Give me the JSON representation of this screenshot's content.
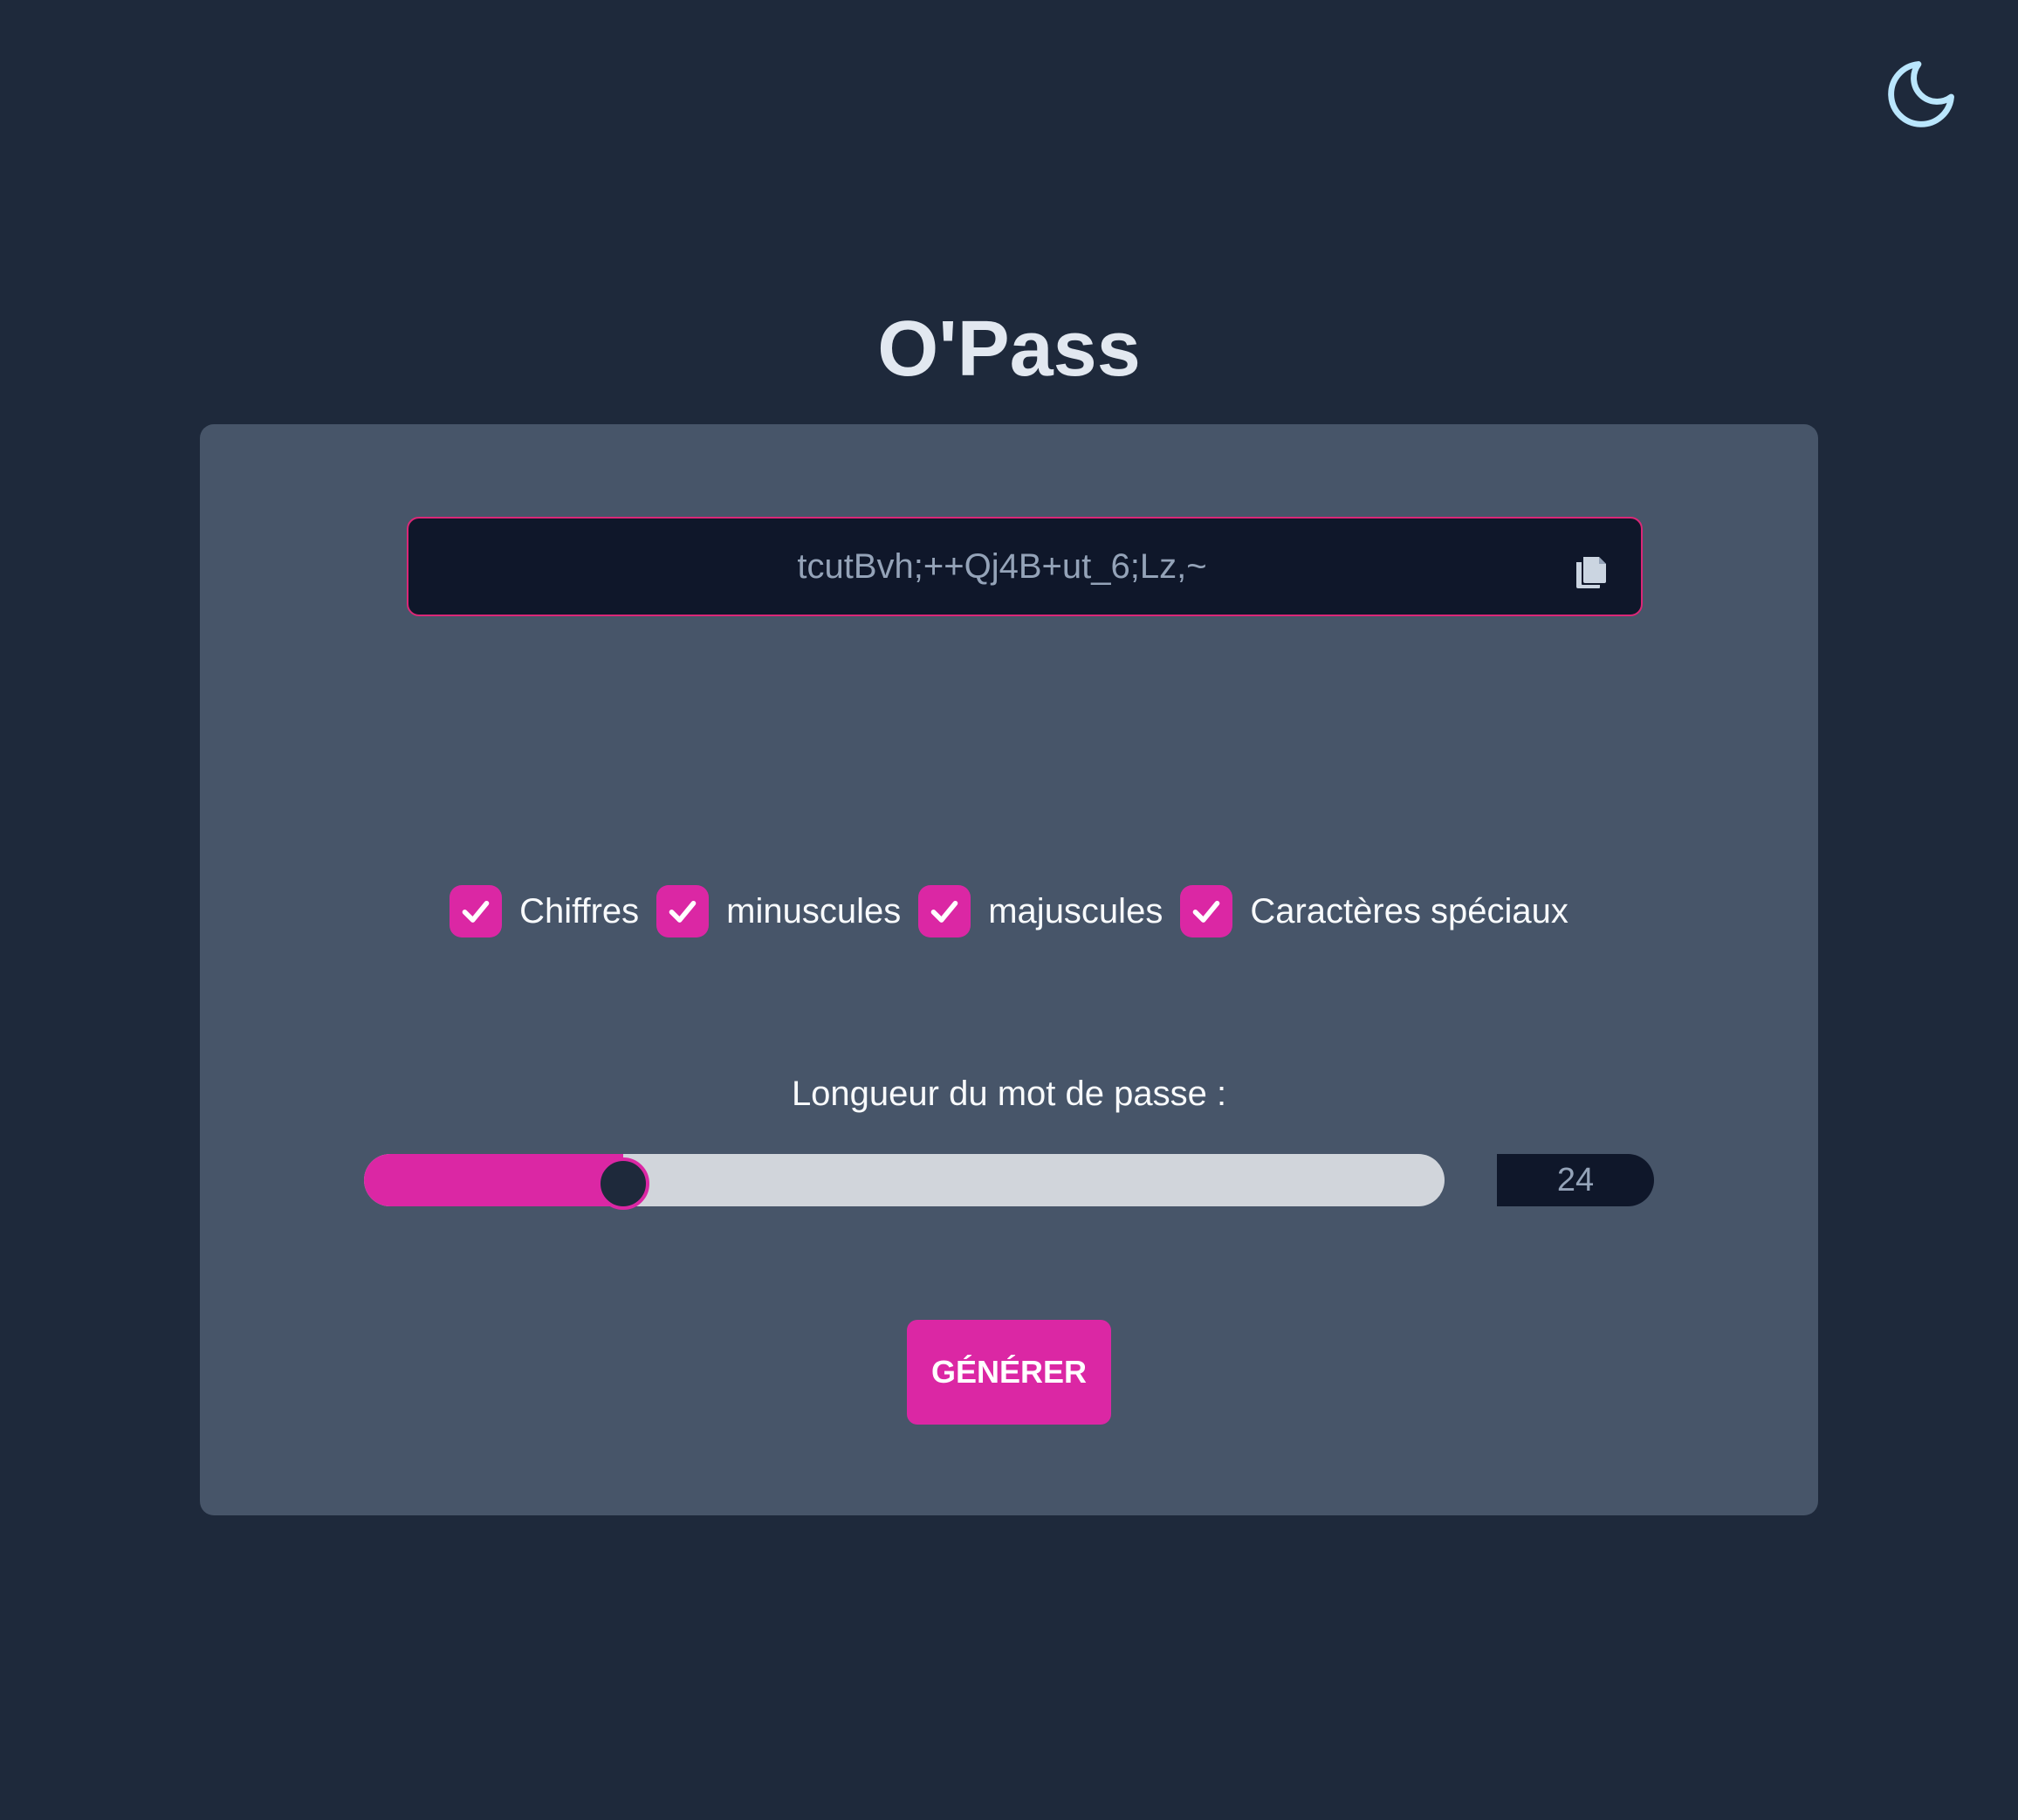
{
  "app": {
    "title": "O'Pass",
    "theme_toggle_icon": "moon-icon"
  },
  "password": {
    "value": "tcutBvh;++Qj4B+ut_6;Lz,~",
    "copy_icon": "copy-icon"
  },
  "options": [
    {
      "label": "Chiffres",
      "checked": true
    },
    {
      "label": "minuscules",
      "checked": true
    },
    {
      "label": "majuscules",
      "checked": true
    },
    {
      "label": "Caractères spéciaux",
      "checked": true
    }
  ],
  "length": {
    "label": "Longueur du mot de passe :",
    "value": "24",
    "slider_fraction": 0.24
  },
  "generate_button": {
    "label": "GÉNÉRER"
  },
  "colors": {
    "background": "#1e293b",
    "card": "#475569",
    "accent": "#db27a4",
    "field": "#0f172a",
    "moon": "#bae6fd"
  }
}
